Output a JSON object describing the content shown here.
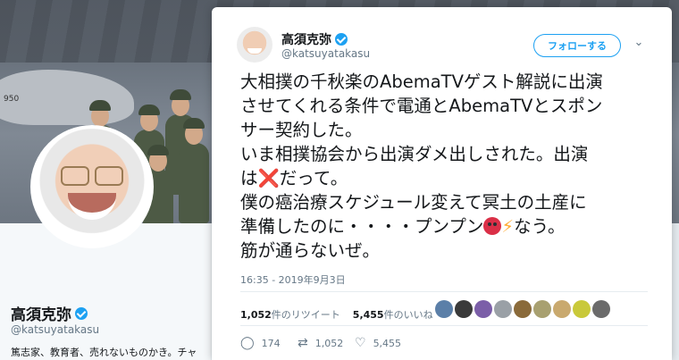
{
  "background": {
    "banner_text": "950",
    "profile": {
      "name": "高須克弥",
      "handle": "@katsuyatakasu",
      "bio": "篤志家、教育者、売れないものかき。チャ"
    }
  },
  "tweet": {
    "author": {
      "name": "高須克弥",
      "handle": "@katsuyatakasu",
      "verified": true
    },
    "follow_label": "フォローする",
    "text_lines": [
      "大相撲の千秋楽のAbemaTVゲスト解説に出演",
      "させてくれる条件で電通とAbemaTVとスポン",
      "サー契約した。",
      "いま相撲協会から出演ダメ出しされた。出演",
      "は",
      "だって。",
      "僕の癌治療スケジュール変えて冥土の土産に",
      "準備したのに・・・・プンプン",
      "なう。",
      "筋が通らないぜ。"
    ],
    "emoji": {
      "cross": "❌",
      "bolt": "⚡"
    },
    "timestamp": "16:35 - 2019年9月3日",
    "stats": {
      "retweets_count": "1,052",
      "retweets_label": "件のリツイート",
      "likes_count": "5,455",
      "likes_label": "件のいいね"
    },
    "likers": [
      "#5b7fa8",
      "#3a3a3a",
      "#7b5ea8",
      "#9aa0a6",
      "#8a6a3a",
      "#a8a070",
      "#c9a96e",
      "#c9c93a",
      "#6b6b6b"
    ],
    "actions": {
      "reply_count": "174",
      "retweet_count": "1,052",
      "like_count": "5,455"
    }
  },
  "colors": {
    "accent": "#1da1f2",
    "secondary_text": "#657786",
    "primary_text": "#14171a"
  }
}
